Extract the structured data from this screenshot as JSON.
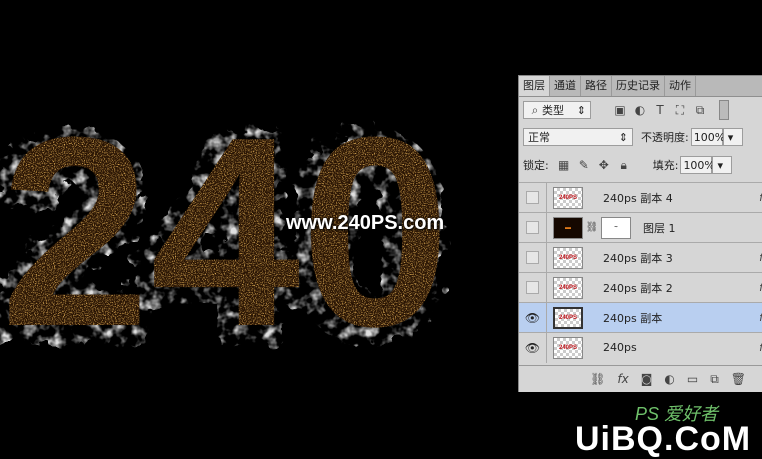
{
  "canvas": {
    "watermark": "www.240PS.com",
    "artwork_text": "240PS"
  },
  "panel": {
    "tabs": [
      "图层",
      "通道",
      "路径",
      "历史记录",
      "动作"
    ],
    "filter": {
      "label": "类型"
    },
    "blend_mode": "正常",
    "opacity_label": "不透明度:",
    "opacity_value": "100%",
    "lock_label": "锁定:",
    "fill_label": "填充:",
    "fill_value": "100%",
    "layers": [
      {
        "name": "240ps 副本 4",
        "visible": false,
        "selected": false,
        "thumb": "240PS"
      },
      {
        "name": "图层 1",
        "visible": false,
        "selected": false,
        "thumb": "",
        "has_mask": true
      },
      {
        "name": "240ps 副本 3",
        "visible": false,
        "selected": false,
        "thumb": "240PS"
      },
      {
        "name": "240ps 副本 2",
        "visible": false,
        "selected": false,
        "thumb": "240PS"
      },
      {
        "name": "240ps 副本",
        "visible": true,
        "selected": true,
        "thumb": "240PS"
      },
      {
        "name": "240ps",
        "visible": true,
        "selected": false,
        "thumb": "240PS"
      }
    ],
    "bottom_icons": [
      "link-icon",
      "fx-icon",
      "mask-icon",
      "adjustment-icon",
      "group-icon",
      "new-layer-icon"
    ]
  },
  "footer_watermark": {
    "brand": "UiBQ.CoM",
    "sub": "PS 爱好者"
  },
  "colors": {
    "accent_selected": "#b9cff0",
    "gold": "#d9892b",
    "panel_bg": "#d6d6d6"
  }
}
